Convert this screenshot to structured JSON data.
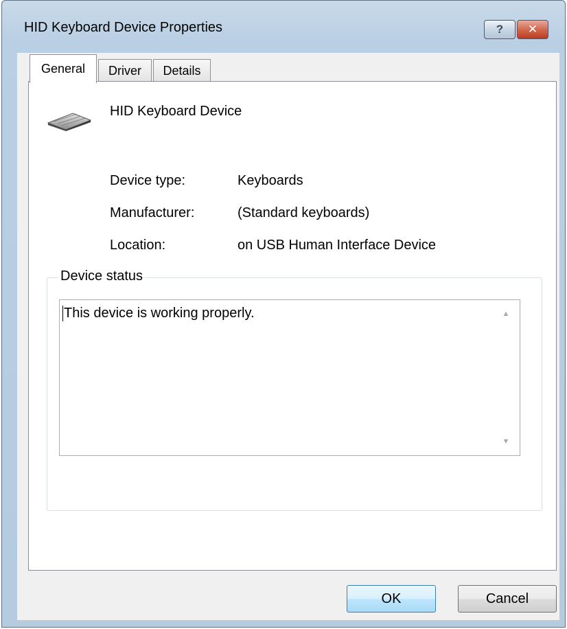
{
  "window": {
    "title": "HID Keyboard Device Properties",
    "help_glyph": "?",
    "close_glyph": "✕"
  },
  "tabs": [
    {
      "label": "General",
      "active": true
    },
    {
      "label": "Driver",
      "active": false
    },
    {
      "label": "Details",
      "active": false
    }
  ],
  "device": {
    "icon": "keyboard-icon",
    "name": "HID Keyboard Device"
  },
  "properties": [
    {
      "label": "Device type:",
      "value": "Keyboards"
    },
    {
      "label": "Manufacturer:",
      "value": "(Standard keyboards)"
    },
    {
      "label": "Location:",
      "value": "on USB Human Interface Device"
    }
  ],
  "status": {
    "title": "Device status",
    "text": "This device is working properly.",
    "scroll_up": "▲",
    "scroll_down": "▼"
  },
  "buttons": {
    "ok": "OK",
    "cancel": "Cancel"
  }
}
